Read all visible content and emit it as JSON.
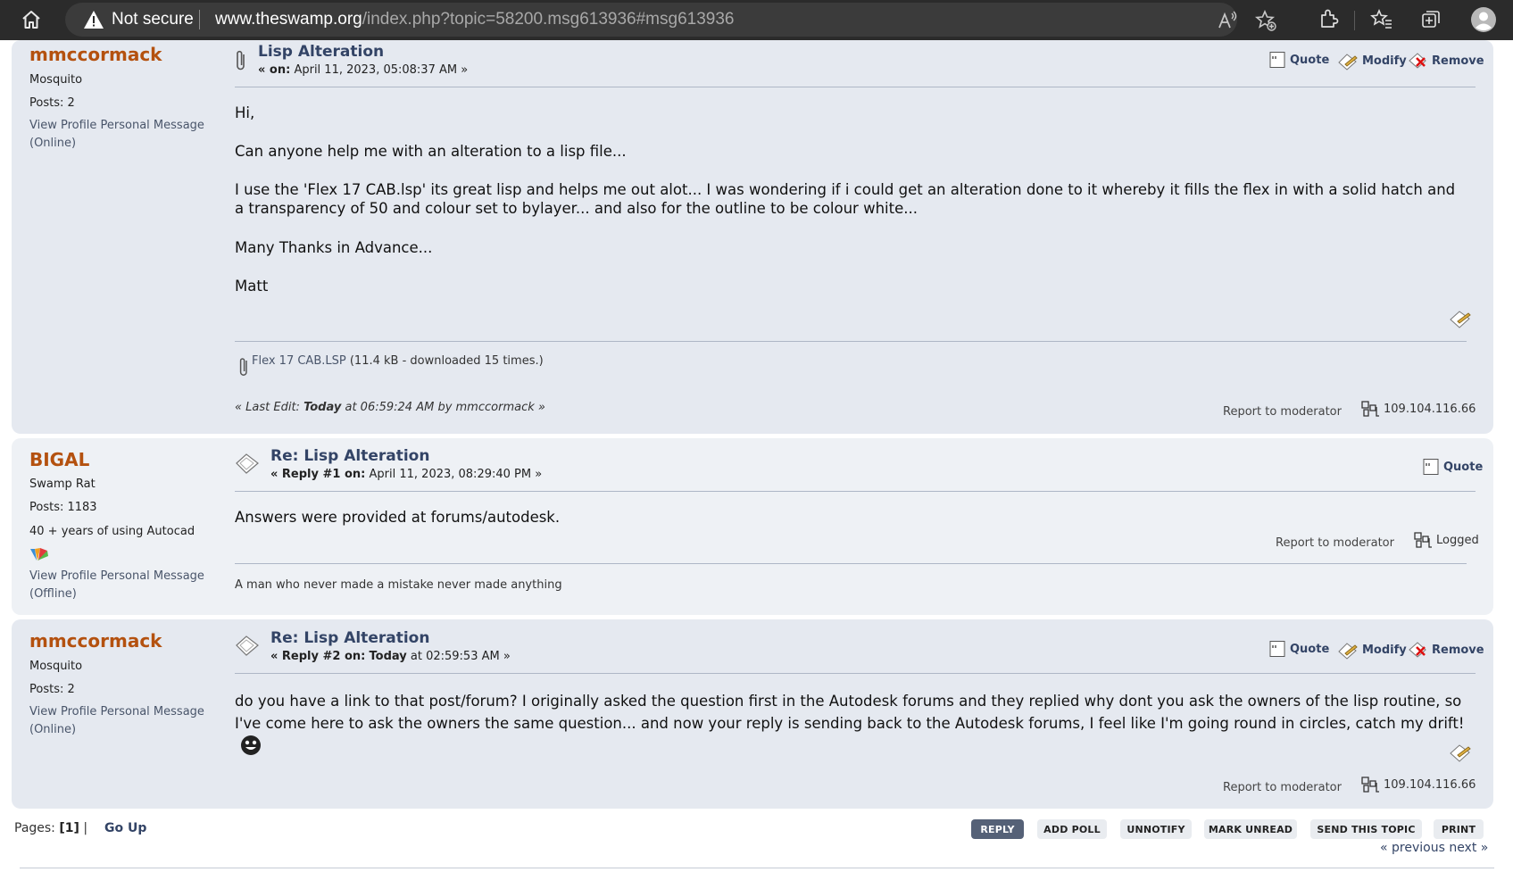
{
  "browser": {
    "security_label": "Not secure",
    "url_host": "www.theswamp.org",
    "url_path": "/index.php?topic=58200.msg613936#msg613936"
  },
  "posts": [
    {
      "username": "mmccormack",
      "rank": "Mosquito",
      "posts": "Posts: 2",
      "profile_link": "View Profile Personal Message (Online)",
      "subject": "Lisp Alteration",
      "meta_prefix": "« on:",
      "meta_date": "April 11, 2023, 05:08:37 AM »",
      "actions": {
        "quote": "Quote",
        "modify": "Modify",
        "remove": "Remove"
      },
      "body": [
        "Hi,",
        "Can anyone help me with an alteration to a lisp file...",
        "I use the 'Flex 17 CAB.lsp' its great lisp and helps me out alot...  I was wondering if i could get an alteration done to it whereby it fills the flex in with a solid hatch and a transparency of 50 and colour set to bylayer...  and also for the outline to be colour white...",
        "Many Thanks in Advance...",
        "Matt"
      ],
      "attachment": {
        "name": "Flex 17 CAB.LSP",
        "info": "(11.4 kB - downloaded 15 times.)"
      },
      "last_edit": {
        "prefix": "« Last Edit:",
        "when": "Today",
        "rest": "at 06:59:24 AM by mmccormack »"
      },
      "report": "Report to moderator",
      "ip": "109.104.116.66"
    },
    {
      "username": "BIGAL",
      "rank": "Swamp Rat",
      "posts": "Posts: 1183",
      "custom_title": "40 + years of using Autocad",
      "profile_link": "View Profile Personal Message (Offline)",
      "subject": "Re: Lisp Alteration",
      "meta_prefix": "« Reply #1 on:",
      "meta_date": "April 11, 2023, 08:29:40 PM »",
      "actions": {
        "quote": "Quote"
      },
      "body": [
        "Answers were provided at forums/autodesk."
      ],
      "report": "Report to moderator",
      "logged": "Logged",
      "signature": "A man who never made a mistake never made anything"
    },
    {
      "username": "mmccormack",
      "rank": "Mosquito",
      "posts": "Posts: 2",
      "profile_link": "View Profile Personal Message (Online)",
      "subject": "Re: Lisp Alteration",
      "meta_prefix": "« Reply #2 on:",
      "meta_when": "Today",
      "meta_date": "at 02:59:53 AM »",
      "actions": {
        "quote": "Quote",
        "modify": "Modify",
        "remove": "Remove"
      },
      "body": [
        "do you have a link to that post/forum?   I originally asked the question first in the Autodesk forums and they replied why dont you ask the owners of the lisp routine, so I've come here to ask the owners the same question... and now your reply is sending back to the Autodesk forums, I feel like I'm going round in circles, catch my drift!"
      ],
      "report": "Report to moderator",
      "ip": "109.104.116.66"
    }
  ],
  "footer": {
    "pages_label": "Pages:",
    "current_page": "[1]",
    "pages_sep": "|",
    "go_up": "Go Up",
    "buttons": [
      "REPLY",
      "ADD POLL",
      "UNNOTIFY",
      "MARK UNREAD",
      "SEND THIS TOPIC",
      "PRINT"
    ],
    "prev_next": "« previous next »"
  },
  "colors": {
    "username": "#b4510f",
    "post_bg": "#e5e9f0",
    "link": "#334466",
    "reply_button": "#556177"
  }
}
